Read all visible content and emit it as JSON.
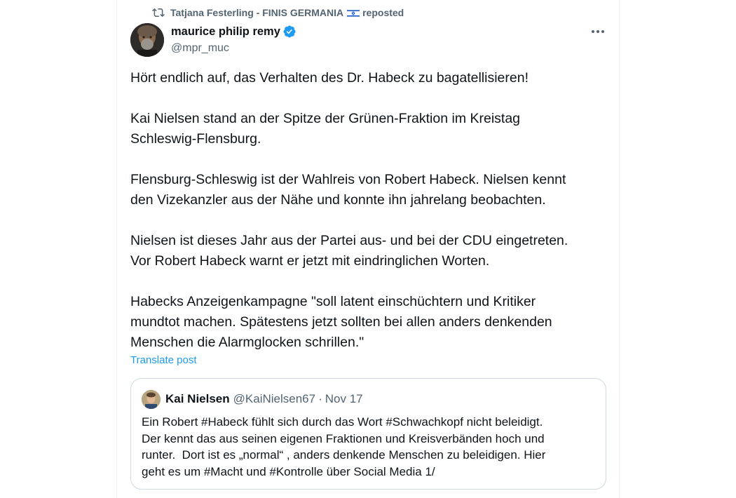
{
  "repost": {
    "reposter_name": "Tatjana Festerling - FINIS GERMANIA",
    "reposted_label": "reposted",
    "icon": "repost-icon",
    "flag": "israel-flag-icon"
  },
  "post": {
    "author_name": "maurice philip remy",
    "author_handle": "@mpr_muc",
    "verified_icon": "verified-badge-icon",
    "more_icon": "more-icon",
    "paragraphs": [
      "Hört endlich auf, das Verhalten des Dr. Habeck zu bagatellisieren!",
      "Kai Nielsen stand an der Spitze der Grünen-Fraktion im Kreistag\nSchleswig-Flensburg.",
      "Flensburg-Schleswig ist der Wahlreis von Robert Habeck. Nielsen kennt\nden Vizekanzler aus der Nähe und konnte ihn jahrelang beobachten.",
      "Nielsen ist dieses Jahr aus der Partei aus- und bei der CDU eingetreten.\nVor Robert Habeck warnt er jetzt mit eindringlichen Worten.",
      "Habecks Anzeigenkampagne \"soll latent einschüchtern und Kritiker\nmundtot machen. Spätestens jetzt sollten bei allen anders denkenden\nMenschen die Alarmglocken schrillen.\""
    ],
    "translate_label": "Translate post"
  },
  "quote": {
    "author_name": "Kai Nielsen",
    "author_handle": "@KaiNielsen67",
    "separator": "·",
    "date": "Nov 17",
    "text": "Ein Robert #Habeck fühlt sich durch das Wort #Schwachkopf nicht beleidigt.\nDer kennt das aus seinen eigenen Fraktionen und Kreisverbänden hoch und\nrunter.  Dort ist es „normal“ , anders denkende Menschen zu beleidigen. Hier\ngeht es um #Macht und #Kontrolle über Social Media 1/"
  },
  "colors": {
    "text_primary": "#0f1419",
    "text_secondary": "#536471",
    "link": "#1d9bf0",
    "border": "#cfd9de"
  }
}
